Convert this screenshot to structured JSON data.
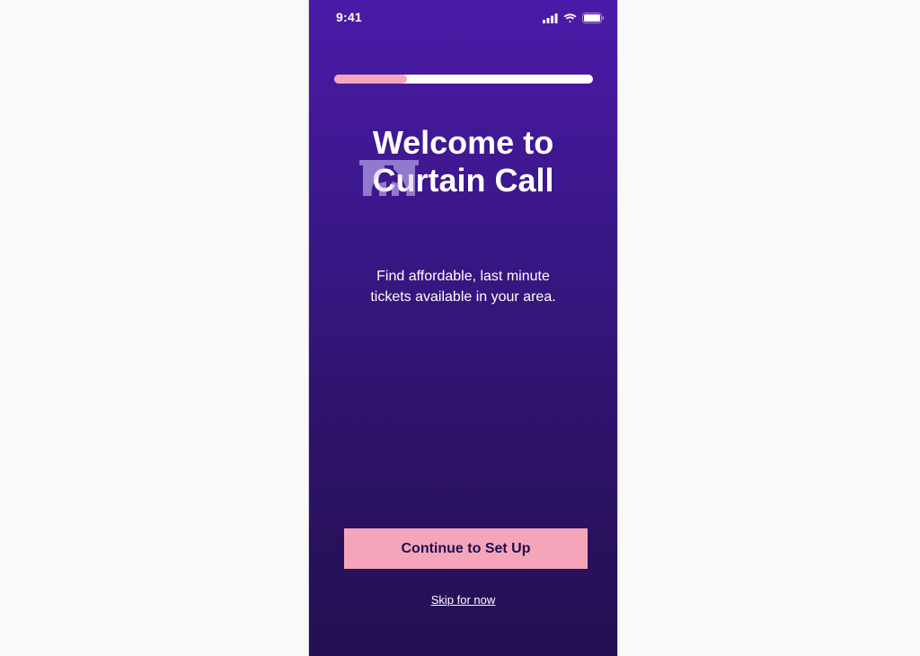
{
  "status_bar": {
    "time": "9:41",
    "icons": [
      "signal-icon",
      "wifi-icon",
      "battery-icon"
    ]
  },
  "progress": {
    "value": 0.28
  },
  "hero": {
    "title": "Welcome to\nCurtain Call",
    "logo": "curtain-logo-icon"
  },
  "subtitle": "Find affordable, last minute\ntickets available in your area.",
  "actions": {
    "continue_label": "Continue to Set Up",
    "skip_label": "Skip for now"
  },
  "colors": {
    "gradient_top": "#4b1aa8",
    "gradient_bottom": "#241052",
    "accent_pink": "#f5a5ba",
    "button_text": "#1e0f4c"
  }
}
